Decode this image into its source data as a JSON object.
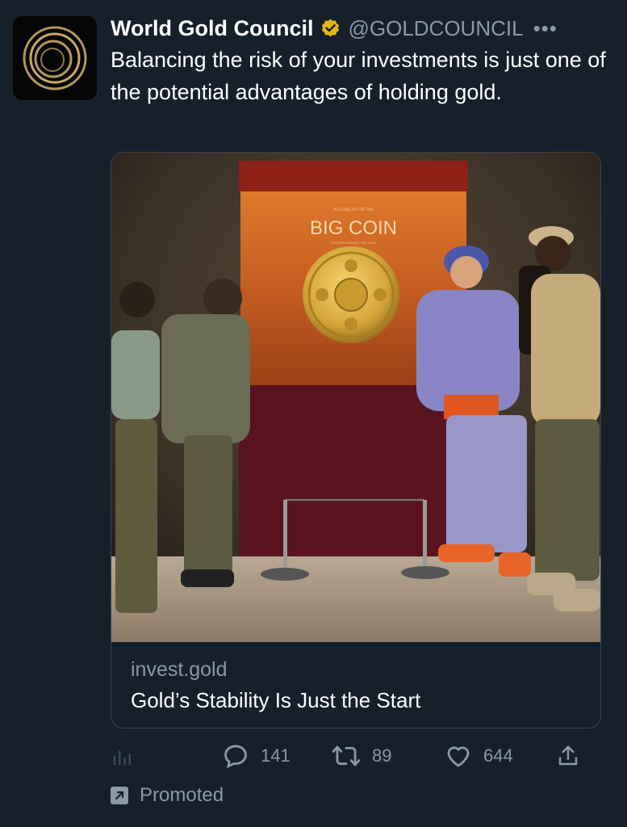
{
  "author": {
    "name": "World Gold Council",
    "handle": "@GOLDCOUNCIL",
    "verified": true,
    "avatar_icon": "gold-rings-logo"
  },
  "tweet": {
    "text": "Balancing the risk of your investments is just one of the potential advantages of holding gold."
  },
  "card": {
    "domain": "invest.gold",
    "title": "Gold’s Stability Is Just the Start",
    "image": {
      "description_icon": "big-coin-exhibit-photo",
      "sign_small_top": "A CLOSE UP ON THE",
      "sign_title": "BIG COIN",
      "sign_small_bottom": "CROWDSTANDING THE GOLD"
    }
  },
  "actions": {
    "analytics_icon": "analytics-icon",
    "replies": "141",
    "retweets": "89",
    "likes": "644",
    "share_icon": "share-icon"
  },
  "promoted_label": "Promoted",
  "colors": {
    "background": "#15202b",
    "secondary_text": "#8b98a5",
    "verified_gold": "#e2b719",
    "border": "#38444d"
  }
}
